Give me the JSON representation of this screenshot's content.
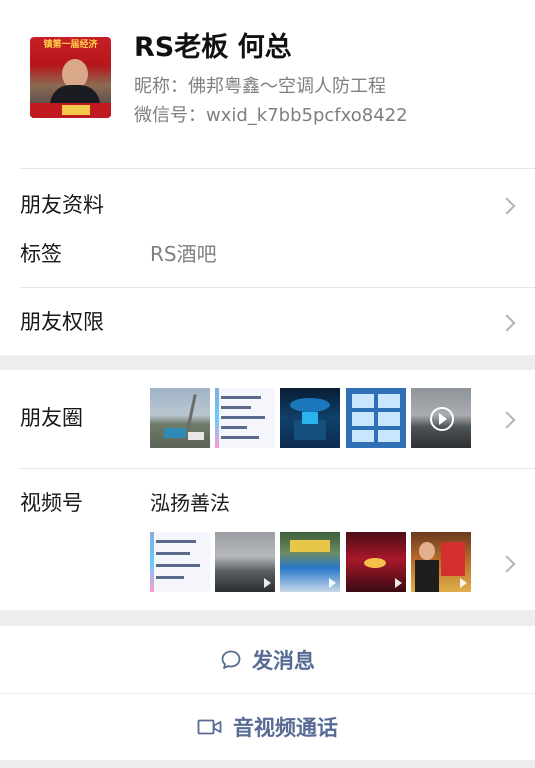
{
  "profile": {
    "display_name": "RS老板 何总",
    "nickname": "昵称：佛邦粤鑫～空调人防工程",
    "wechat_id": "微信号：wxid_k7bb5pcfxo8422",
    "avatar_banner_text": "镇第一届经济"
  },
  "rows": {
    "friend_profile": "朋友资料",
    "tags_label": "标签",
    "tags_value": "RS酒吧",
    "friend_permissions": "朋友权限",
    "moments_label": "朋友圈",
    "channels_label": "视频号",
    "channels_name": "泓扬善法"
  },
  "actions": {
    "message": "发消息",
    "call": "音视频通话"
  },
  "icons": {
    "chevron": "chevron-right-icon",
    "message": "chat-bubble-icon",
    "call": "video-camera-icon"
  },
  "colors": {
    "link_blue": "#576b95",
    "background": "#ededed"
  }
}
